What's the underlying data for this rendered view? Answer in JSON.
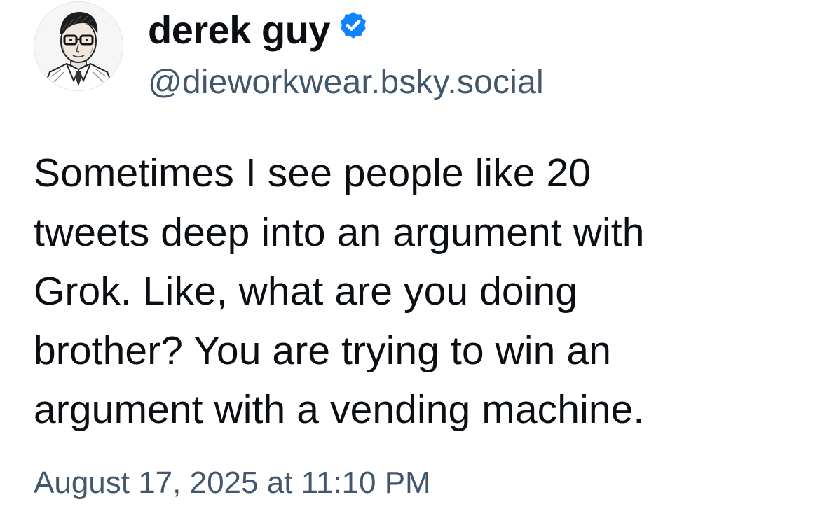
{
  "post": {
    "author": {
      "display_name": "derek guy",
      "handle": "@dieworkwear.bsky.social",
      "verified": true,
      "verified_icon": "verified-checkmark-icon",
      "avatar_icon": "illustrated-portrait-avatar"
    },
    "text": "Sometimes I see people like 20\ntweets deep into an argument with\nGrok. Like, what are you doing\nbrother? You are trying to win an\nargument with a vending machine.",
    "timestamp": "August 17, 2025 at 11:10 PM"
  },
  "colors": {
    "text_primary": "#0b0f14",
    "text_secondary": "#42576c",
    "verified_blue": "#1083fe",
    "background": "#ffffff"
  }
}
